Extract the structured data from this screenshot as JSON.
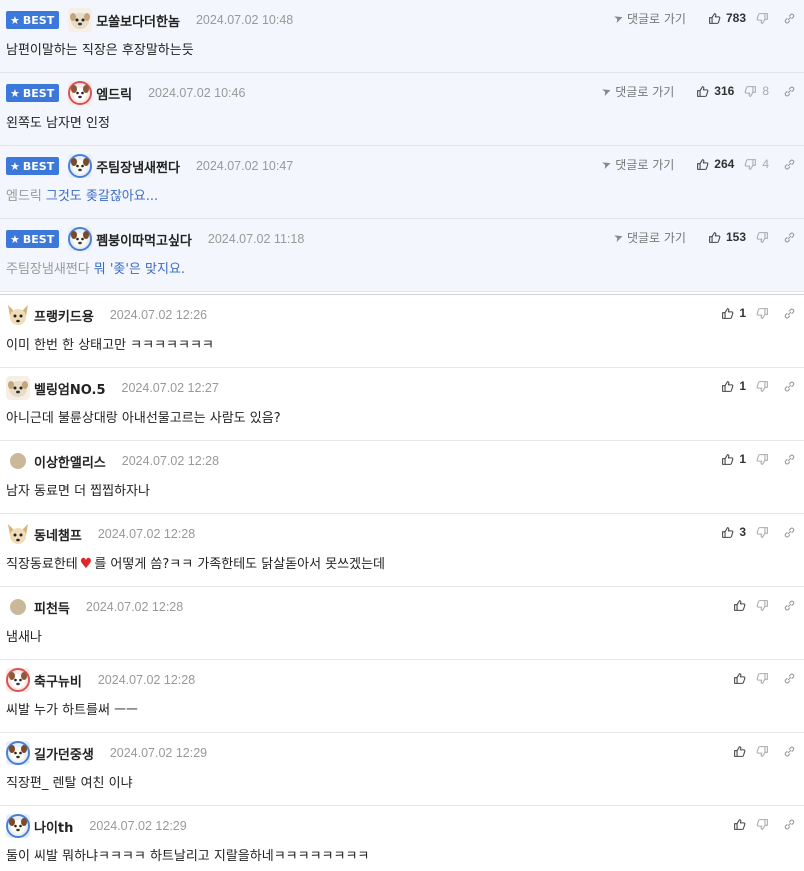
{
  "labels": {
    "best": "BEST",
    "reply": "댓글로 가기"
  },
  "best_comments": [
    {
      "nick": "모쏠보다더한놈",
      "date": "2024.07.02 10:48",
      "text": "남편이말하는 직장은 후장말하는듯",
      "up": "783",
      "down": "",
      "avatar": "dog-pale"
    },
    {
      "nick": "엠드릭",
      "date": "2024.07.02 10:46",
      "text": "왼쪽도 남자면 인정",
      "up": "316",
      "down": "8",
      "avatar": "dog-red"
    },
    {
      "nick": "주팀장냄새쩐다",
      "date": "2024.07.02 10:47",
      "mention": "엠드릭",
      "text": "그것도 좆갈잖아요...",
      "up": "264",
      "down": "4",
      "avatar": "dog-blue"
    },
    {
      "nick": "펨붕이따먹고싶다",
      "date": "2024.07.02 11:18",
      "mention": "주팀장냄새쩐다",
      "text": "뭐 '좆'은 맞지요.",
      "up": "153",
      "down": "",
      "avatar": "dog-blue"
    }
  ],
  "comments": [
    {
      "nick": "프랭키드용",
      "date": "2024.07.02 12:26",
      "text": "이미 한번 한 상태고만 ㅋㅋㅋㅋㅋㅋㅋ",
      "up": "1",
      "avatar": "fox"
    },
    {
      "nick": "벨링엄NO.5",
      "date": "2024.07.02 12:27",
      "text": "아니근데 불륜상대랑 아내선물고르는 사람도 있음?",
      "up": "1",
      "avatar": "dog-pale"
    },
    {
      "nick": "이상한앨리스",
      "date": "2024.07.02 12:28",
      "text": "남자 동료면 더 찝찝하자나",
      "up": "1",
      "avatar": "dot"
    },
    {
      "nick": "동네챔프",
      "date": "2024.07.02 12:28",
      "text_before": "직장동료한테",
      "text_after": "를 어떻게 씀?ㅋㅋ 가족한테도 닭살돋아서 못쓰겠는데",
      "heart": "♥",
      "up": "3",
      "avatar": "fox"
    },
    {
      "nick": "피천득",
      "date": "2024.07.02 12:28",
      "text": "냄새나",
      "up": "",
      "avatar": "dot"
    },
    {
      "nick": "축구뉴비",
      "date": "2024.07.02 12:28",
      "text": "씨발 누가 하트를써 ㅡㅡ",
      "up": "",
      "avatar": "dog-red"
    },
    {
      "nick": "길가던중생",
      "date": "2024.07.02 12:29",
      "text": "직장편_ 렌탈 여친 이냐",
      "up": "",
      "avatar": "dog-blue"
    },
    {
      "nick": "나이th",
      "date": "2024.07.02 12:29",
      "text": "둘이 씨발 뭐하냐ㅋㅋㅋㅋ 하트날리고 지랄을하네ㅋㅋㅋㅋㅋㅋㅋㅋ",
      "up": "",
      "avatar": "dog-blue"
    }
  ],
  "colors": {
    "best_bg": "#f3f6fd",
    "badge": "#3b78d9",
    "mention": "#999999",
    "reply_text": "#3b6cc7",
    "heart": "#e0262b"
  },
  "icons": {
    "badge": "star-icon",
    "reply": "send-icon",
    "up": "thumbs-up-icon",
    "down": "thumbs-down-icon",
    "link": "link-icon"
  }
}
